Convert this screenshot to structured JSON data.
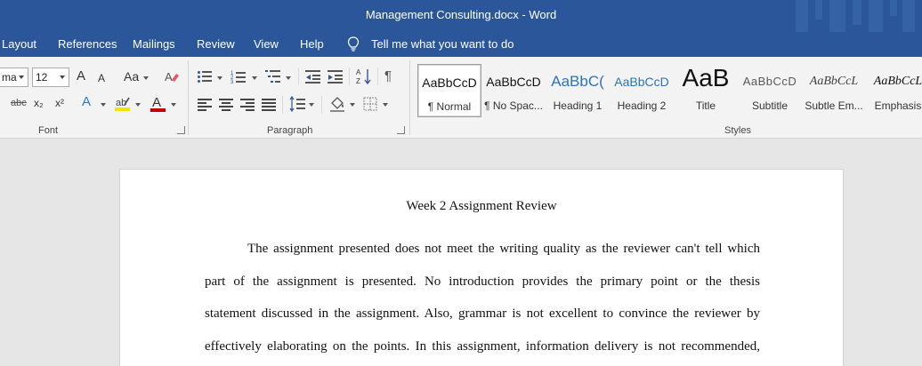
{
  "window": {
    "title": "Management Consulting.docx  -  Word"
  },
  "menu": {
    "items": [
      "Layout",
      "References",
      "Mailings",
      "Review",
      "View",
      "Help"
    ],
    "tell_me": "Tell me what you want to do"
  },
  "font": {
    "name": "ma",
    "size": "12",
    "grow": "A",
    "shrink": "A",
    "case": "Aa",
    "strike": "abc",
    "subscript": "x₂",
    "superscript": "x²",
    "effects": "A",
    "font_color": "A",
    "group_label": "Font",
    "highlight_color": "#f5e400",
    "font_color_value": "#c00000"
  },
  "paragraph": {
    "group_label": "Paragraph",
    "pilcrow": "¶"
  },
  "styles": {
    "group_label": "Styles",
    "items": [
      {
        "sample": "AaBbCcD",
        "name": "¶ Normal"
      },
      {
        "sample": "AaBbCcD",
        "name": "¶ No Spac..."
      },
      {
        "sample": "AaBbC(",
        "name": "Heading 1"
      },
      {
        "sample": "AaBbCcD",
        "name": "Heading 2"
      },
      {
        "sample": "AaB",
        "name": "Title"
      },
      {
        "sample": "AaBbCcD",
        "name": "Subtitle"
      },
      {
        "sample": "AaBbCcL",
        "name": "Subtle Em..."
      },
      {
        "sample": "AaBbCcL",
        "name": "Emphasis"
      }
    ]
  },
  "document": {
    "title": "Week 2 Assignment Review",
    "lines": [
      "The assignment presented does not meet the writing quality as the reviewer can't tell which",
      "part of the assignment is presented. No introduction provides the primary point or the thesis",
      "statement discussed in the assignment. Also, grammar is not excellent to convince the reviewer by",
      "effectively elaborating on the points. In this assignment, information delivery is not recommended,"
    ]
  }
}
